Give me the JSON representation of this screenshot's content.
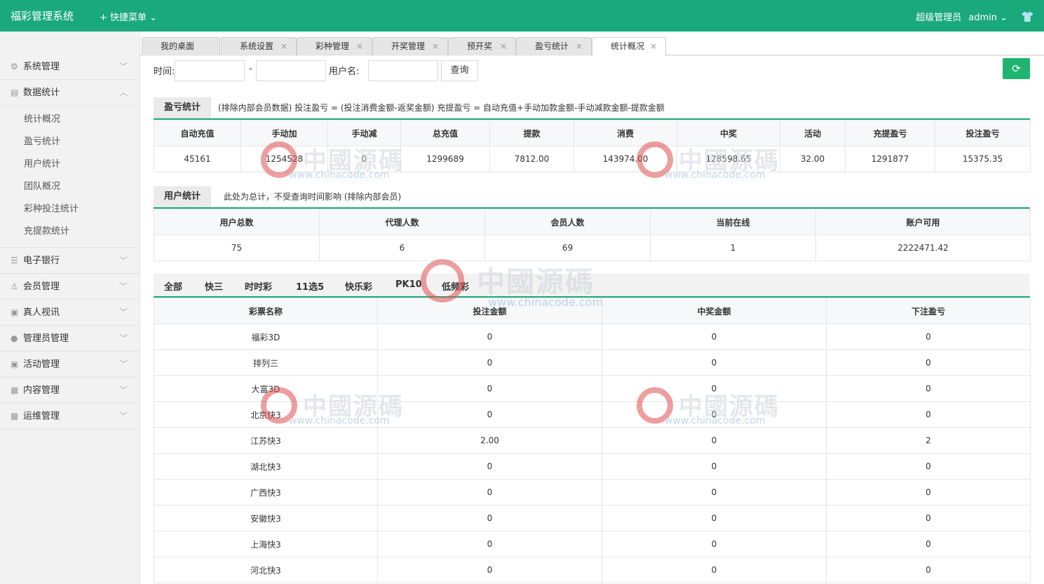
{
  "header": {
    "brand": "福彩管理系统",
    "quick_menu": "+ 快捷菜单 ⌄",
    "role": "超级管理员",
    "username": "admin ⌄",
    "shirt_icon": "👕"
  },
  "sidebar": {
    "items": [
      {
        "label": "系统管理",
        "icon": "gear-icon"
      },
      {
        "label": "数据统计",
        "icon": "chart-icon",
        "expanded": true,
        "children": [
          "统计概况",
          "盈亏统计",
          "用户统计",
          "团队概况",
          "彩种投注统计",
          "充提款统计"
        ]
      },
      {
        "label": "电子银行",
        "icon": "list-icon"
      },
      {
        "label": "会员管理",
        "icon": "user-icon"
      },
      {
        "label": "真人视讯",
        "icon": "gift-icon"
      },
      {
        "label": "管理员管理",
        "icon": "admin-icon"
      },
      {
        "label": "活动管理",
        "icon": "gift-icon"
      },
      {
        "label": "内容管理",
        "icon": "doc-icon"
      },
      {
        "label": "运维管理",
        "icon": "doc-icon"
      }
    ]
  },
  "tabs": [
    "我的桌面",
    "系统设置",
    "彩种管理",
    "开奖管理",
    "预开奖",
    "盈亏统计",
    "统计概况"
  ],
  "filter": {
    "time_label": "时间:",
    "dash": "-",
    "user_label": "用户名:",
    "query": "查询",
    "time_start": "",
    "time_end": "",
    "username": ""
  },
  "profit": {
    "title": "盈亏统计",
    "note": "(排除内部会员数据) 投注盈亏 = (投注消费金额-返奖金额)    充提盈亏 = 自动充值+手动加款金额-手动减款金额-提款金额",
    "headers": [
      "自动充值",
      "手动加",
      "手动减",
      "总充值",
      "提款",
      "消费",
      "中奖",
      "活动",
      "充提盈亏",
      "投注盈亏"
    ],
    "values": [
      "45161",
      "1254528",
      "0",
      "1299689",
      "7812.00",
      "143974.00",
      "128598.65",
      "32.00",
      "1291877",
      "15375.35"
    ]
  },
  "users": {
    "title": "用户统计",
    "note": "此处为总计，不受查询时间影响 (排除内部会员)",
    "headers": [
      "用户总数",
      "代理人数",
      "会员人数",
      "当前在线",
      "账户可用"
    ],
    "values": [
      "75",
      "6",
      "69",
      "1",
      "2222471.42"
    ]
  },
  "lottery_tabs": [
    "全部",
    "快三",
    "时时彩",
    "11选5",
    "快乐彩",
    "PK10",
    "低频彩"
  ],
  "lottery": {
    "headers": [
      "彩票名称",
      "投注金额",
      "中奖金额",
      "下注盈亏"
    ],
    "rows": [
      [
        "福彩3D",
        "0",
        "0",
        "0"
      ],
      [
        "排列三",
        "0",
        "0",
        "0"
      ],
      [
        "大富3D",
        "0",
        "0",
        "0"
      ],
      [
        "北京快3",
        "0",
        "0",
        "0"
      ],
      [
        "江苏快3",
        "2.00",
        "0",
        "2"
      ],
      [
        "湖北快3",
        "0",
        "0",
        "0"
      ],
      [
        "广西快3",
        "0",
        "0",
        "0"
      ],
      [
        "安徽快3",
        "0",
        "0",
        "0"
      ],
      [
        "上海快3",
        "0",
        "0",
        "0"
      ],
      [
        "河北快3",
        "0",
        "0",
        "0"
      ]
    ]
  },
  "watermark": {
    "text": "中國源碼",
    "url": "www.chinacode.com"
  }
}
